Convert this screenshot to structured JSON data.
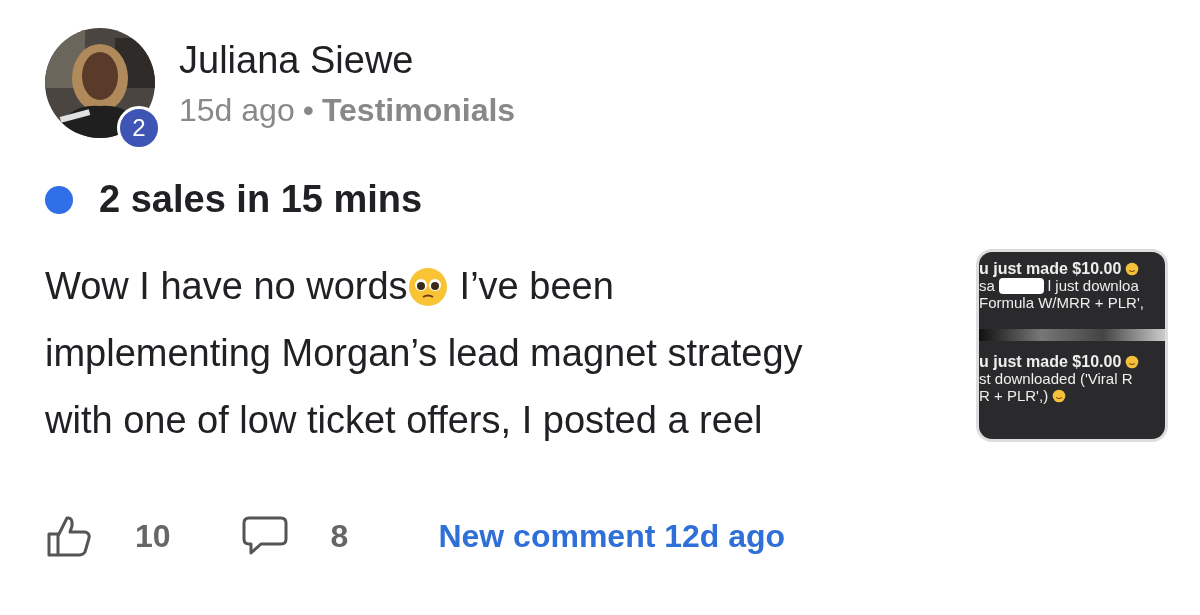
{
  "post": {
    "author": "Juliana Siewe",
    "level_badge": "2",
    "time": "15d ago",
    "separator": "•",
    "category": "Testimonials",
    "title": "2 sales in 15 mins",
    "unread": true,
    "body_lines": [
      [
        "Wow I have no words",
        "I’ve been"
      ],
      [
        "implementing Morgan’s lead magnet strategy"
      ],
      [
        "with one of low ticket offers, I posted a reel"
      ]
    ],
    "attachment": {
      "kind": "screenshot",
      "lines": [
        {
          "text": "u just made $10.00",
          "emoji": true
        },
        {
          "text": "sa",
          "text2": "l just downloa",
          "emoji": false
        },
        {
          "text": "Formula W/MRR + PLR',",
          "emoji": false
        },
        {
          "text": "u just made $10.00",
          "emoji": true
        },
        {
          "text": "st downloaded ('Viral R",
          "emoji": false
        },
        {
          "text": "R + PLR',)",
          "emoji": true
        }
      ]
    },
    "likes": "10",
    "comments": "8",
    "last_comment": "New comment 12d ago"
  }
}
